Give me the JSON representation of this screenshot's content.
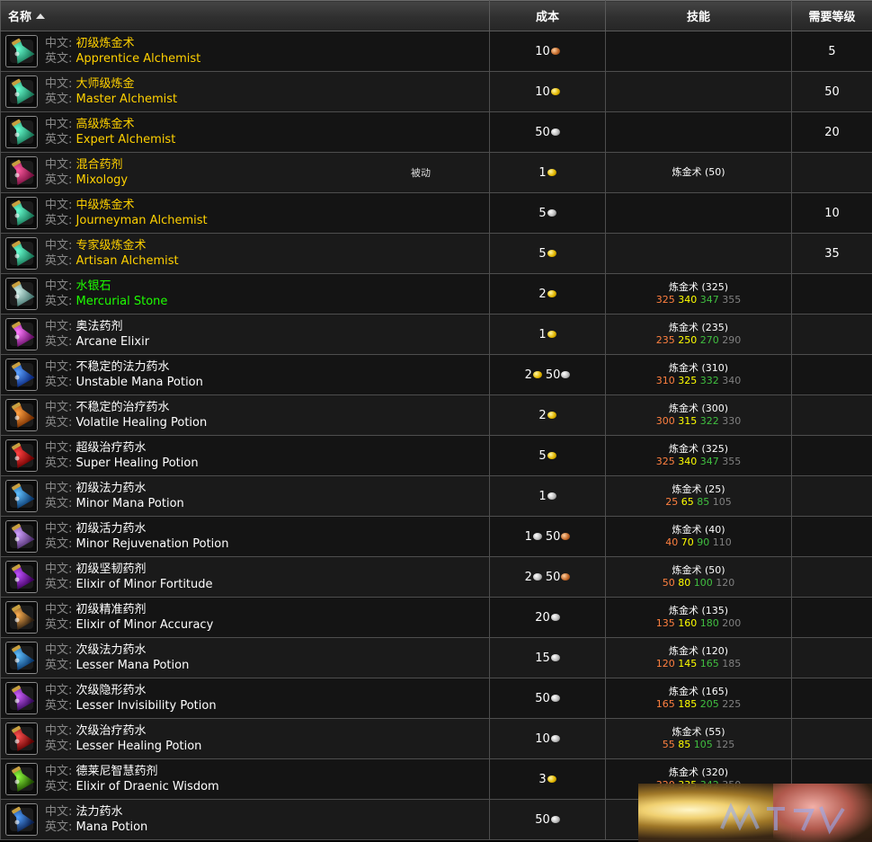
{
  "header": {
    "name": "名称",
    "cost": "成本",
    "skill": "技能",
    "level": "需要等级"
  },
  "labels": {
    "zh_prefix": "中文:",
    "en_prefix": "英文:"
  },
  "rows": [
    {
      "icon": "alchemy-flask-icon",
      "zh": "初级炼金术",
      "en": "Apprentice Alchemist",
      "quality": "yellow",
      "passive": "",
      "cost": [
        {
          "amt": "10",
          "coin": "copper"
        }
      ],
      "skill": "",
      "ranks": [],
      "level": "5"
    },
    {
      "icon": "alchemy-flask-icon",
      "zh": "大师级炼金",
      "en": "Master Alchemist",
      "quality": "yellow",
      "passive": "",
      "cost": [
        {
          "amt": "10",
          "coin": "gold"
        }
      ],
      "skill": "",
      "ranks": [],
      "level": "50"
    },
    {
      "icon": "alchemy-flask-icon",
      "zh": "高级炼金术",
      "en": "Expert Alchemist",
      "quality": "yellow",
      "passive": "",
      "cost": [
        {
          "amt": "50",
          "coin": "silver"
        }
      ],
      "skill": "",
      "ranks": [],
      "level": "20"
    },
    {
      "icon": "mixology-icon",
      "zh": "混合药剂",
      "en": "Mixology",
      "quality": "yellow",
      "passive": "被动",
      "cost": [
        {
          "amt": "1",
          "coin": "gold"
        }
      ],
      "skill": "炼金术 (50)",
      "ranks": [],
      "level": ""
    },
    {
      "icon": "alchemy-flask-icon",
      "zh": "中级炼金术",
      "en": "Journeyman Alchemist",
      "quality": "yellow",
      "passive": "",
      "cost": [
        {
          "amt": "5",
          "coin": "silver"
        }
      ],
      "skill": "",
      "ranks": [],
      "level": "10"
    },
    {
      "icon": "alchemy-flask-icon",
      "zh": "专家级炼金术",
      "en": "Artisan Alchemist",
      "quality": "yellow",
      "passive": "",
      "cost": [
        {
          "amt": "5",
          "coin": "gold"
        }
      ],
      "skill": "",
      "ranks": [],
      "level": "35"
    },
    {
      "icon": "mercurial-stone-icon",
      "zh": "水银石",
      "en": "Mercurial Stone",
      "quality": "green",
      "passive": "",
      "cost": [
        {
          "amt": "2",
          "coin": "gold"
        }
      ],
      "skill": "炼金术 (325)",
      "ranks": [
        "325",
        "340",
        "347",
        "355"
      ],
      "level": ""
    },
    {
      "icon": "arcane-elixir-icon",
      "zh": "奥法药剂",
      "en": "Arcane Elixir",
      "quality": "white",
      "passive": "",
      "cost": [
        {
          "amt": "1",
          "coin": "gold"
        }
      ],
      "skill": "炼金术 (235)",
      "ranks": [
        "235",
        "250",
        "270",
        "290"
      ],
      "level": ""
    },
    {
      "icon": "blue-potion-icon",
      "zh": "不稳定的法力药水",
      "en": "Unstable Mana Potion",
      "quality": "white",
      "passive": "",
      "cost": [
        {
          "amt": "2",
          "coin": "gold"
        },
        {
          "amt": "50",
          "coin": "silver"
        }
      ],
      "skill": "炼金术 (310)",
      "ranks": [
        "310",
        "325",
        "332",
        "340"
      ],
      "level": ""
    },
    {
      "icon": "orange-potion-icon",
      "zh": "不稳定的治疗药水",
      "en": "Volatile Healing Potion",
      "quality": "white",
      "passive": "",
      "cost": [
        {
          "amt": "2",
          "coin": "gold"
        }
      ],
      "skill": "炼金术 (300)",
      "ranks": [
        "300",
        "315",
        "322",
        "330"
      ],
      "level": ""
    },
    {
      "icon": "red-potion-icon",
      "zh": "超级治疗药水",
      "en": "Super Healing Potion",
      "quality": "white",
      "passive": "",
      "cost": [
        {
          "amt": "5",
          "coin": "gold"
        }
      ],
      "skill": "炼金术 (325)",
      "ranks": [
        "325",
        "340",
        "347",
        "355"
      ],
      "level": ""
    },
    {
      "icon": "blue-vial-icon",
      "zh": "初级法力药水",
      "en": "Minor Mana Potion",
      "quality": "white",
      "passive": "",
      "cost": [
        {
          "amt": "1",
          "coin": "silver"
        }
      ],
      "skill": "炼金术 (25)",
      "ranks": [
        "25",
        "65",
        "85",
        "105"
      ],
      "level": ""
    },
    {
      "icon": "purple-box-icon",
      "zh": "初级活力药水",
      "en": "Minor Rejuvenation Potion",
      "quality": "white",
      "passive": "",
      "cost": [
        {
          "amt": "1",
          "coin": "silver"
        },
        {
          "amt": "50",
          "coin": "copper"
        }
      ],
      "skill": "炼金术 (40)",
      "ranks": [
        "40",
        "70",
        "90",
        "110"
      ],
      "level": ""
    },
    {
      "icon": "purple-vial-icon",
      "zh": "初级坚韧药剂",
      "en": "Elixir of Minor Fortitude",
      "quality": "white",
      "passive": "",
      "cost": [
        {
          "amt": "2",
          "coin": "silver"
        },
        {
          "amt": "50",
          "coin": "copper"
        }
      ],
      "skill": "炼金术 (50)",
      "ranks": [
        "50",
        "80",
        "100",
        "120"
      ],
      "level": ""
    },
    {
      "icon": "dark-flask-icon",
      "zh": "初级精准药剂",
      "en": "Elixir of Minor Accuracy",
      "quality": "white",
      "passive": "",
      "cost": [
        {
          "amt": "20",
          "coin": "silver"
        }
      ],
      "skill": "炼金术 (135)",
      "ranks": [
        "135",
        "160",
        "180",
        "200"
      ],
      "level": ""
    },
    {
      "icon": "blue-vial-icon",
      "zh": "次级法力药水",
      "en": "Lesser Mana Potion",
      "quality": "white",
      "passive": "",
      "cost": [
        {
          "amt": "15",
          "coin": "silver"
        }
      ],
      "skill": "炼金术 (120)",
      "ranks": [
        "120",
        "145",
        "165",
        "185"
      ],
      "level": ""
    },
    {
      "icon": "purple-potion-icon",
      "zh": "次级隐形药水",
      "en": "Lesser Invisibility Potion",
      "quality": "white",
      "passive": "",
      "cost": [
        {
          "amt": "50",
          "coin": "silver"
        }
      ],
      "skill": "炼金术 (165)",
      "ranks": [
        "165",
        "185",
        "205",
        "225"
      ],
      "level": ""
    },
    {
      "icon": "red-vial-icon",
      "zh": "次级治疗药水",
      "en": "Lesser Healing Potion",
      "quality": "white",
      "passive": "",
      "cost": [
        {
          "amt": "10",
          "coin": "silver"
        }
      ],
      "skill": "炼金术 (55)",
      "ranks": [
        "55",
        "85",
        "105",
        "125"
      ],
      "level": ""
    },
    {
      "icon": "green-potion-icon",
      "zh": "德莱尼智慧药剂",
      "en": "Elixir of Draenic Wisdom",
      "quality": "white",
      "passive": "",
      "cost": [
        {
          "amt": "3",
          "coin": "gold"
        }
      ],
      "skill": "炼金术 (320)",
      "ranks": [
        "320",
        "335",
        "342",
        "350"
      ],
      "level": ""
    },
    {
      "icon": "blue-square-potion-icon",
      "zh": "法力药水",
      "en": "Mana Potion",
      "quality": "white",
      "passive": "",
      "cost": [
        {
          "amt": "50",
          "coin": "silver"
        }
      ],
      "skill": "",
      "ranks": [],
      "level": ""
    }
  ],
  "icon_colors": {
    "alchemy-flask-icon": [
      "#66ffd0",
      "#1a7a5a"
    ],
    "mixology-icon": [
      "#ff5aa0",
      "#7a1040"
    ],
    "mercurial-stone-icon": [
      "#cfeee8",
      "#4a7a74"
    ],
    "arcane-elixir-icon": [
      "#ff7aff",
      "#6a106a"
    ],
    "blue-potion-icon": [
      "#5aa0ff",
      "#0a2a80"
    ],
    "orange-potion-icon": [
      "#ffa040",
      "#7a3000"
    ],
    "red-potion-icon": [
      "#ff4040",
      "#700000"
    ],
    "blue-vial-icon": [
      "#60c0ff",
      "#0a3a70"
    ],
    "purple-box-icon": [
      "#d0a0ff",
      "#503070"
    ],
    "purple-vial-icon": [
      "#c050ff",
      "#400060"
    ],
    "dark-flask-icon": [
      "#ffb050",
      "#302010"
    ],
    "purple-potion-icon": [
      "#d060ff",
      "#3a0a60"
    ],
    "red-vial-icon": [
      "#ff5050",
      "#600000"
    ],
    "green-potion-icon": [
      "#90ff40",
      "#205000"
    ],
    "blue-square-potion-icon": [
      "#50a0ff",
      "#0a2050"
    ]
  }
}
